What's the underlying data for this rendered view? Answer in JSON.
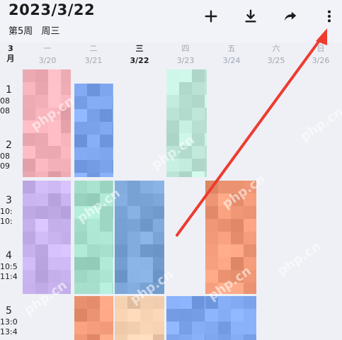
{
  "header": {
    "date_title": "2023/3/22",
    "week_label": "第5周",
    "weekday_label": "周三"
  },
  "toolbar": {
    "add_icon": "plus-icon",
    "download_icon": "download-icon",
    "share_icon": "share-icon",
    "more_icon": "more-vertical-icon"
  },
  "month": {
    "line1": "3",
    "line2": "月"
  },
  "days": [
    {
      "weekday": "一",
      "date": "3/20"
    },
    {
      "weekday": "二",
      "date": "3/21"
    },
    {
      "weekday": "三",
      "date": "3/22",
      "today": true
    },
    {
      "weekday": "四",
      "date": "3/23"
    },
    {
      "weekday": "五",
      "date": "3/24"
    },
    {
      "weekday": "六",
      "date": "3/25"
    },
    {
      "weekday": "日",
      "date": "3/26"
    }
  ],
  "periods": [
    {
      "num": "1",
      "start": "08",
      "end": "08"
    },
    {
      "num": "2",
      "start": "08",
      "end": "09"
    },
    {
      "num": "3",
      "start": "10:",
      "end": "10:"
    },
    {
      "num": "4",
      "start": "10:5",
      "end": "11:4"
    },
    {
      "num": "5",
      "start": "13:0",
      "end": "13:4"
    }
  ],
  "watermark": "php.cn",
  "colors": {
    "accent_arrow": "#ee3b30",
    "pink": "#f3b0b8",
    "blue": "#7ea6ee",
    "mint": "#bfe8db",
    "teal_green": "#a6e0cd",
    "steel_blue": "#7aa4d6",
    "orange": "#f29a78",
    "lavender": "#c9b4f0",
    "peach": "#f5d0b0"
  }
}
